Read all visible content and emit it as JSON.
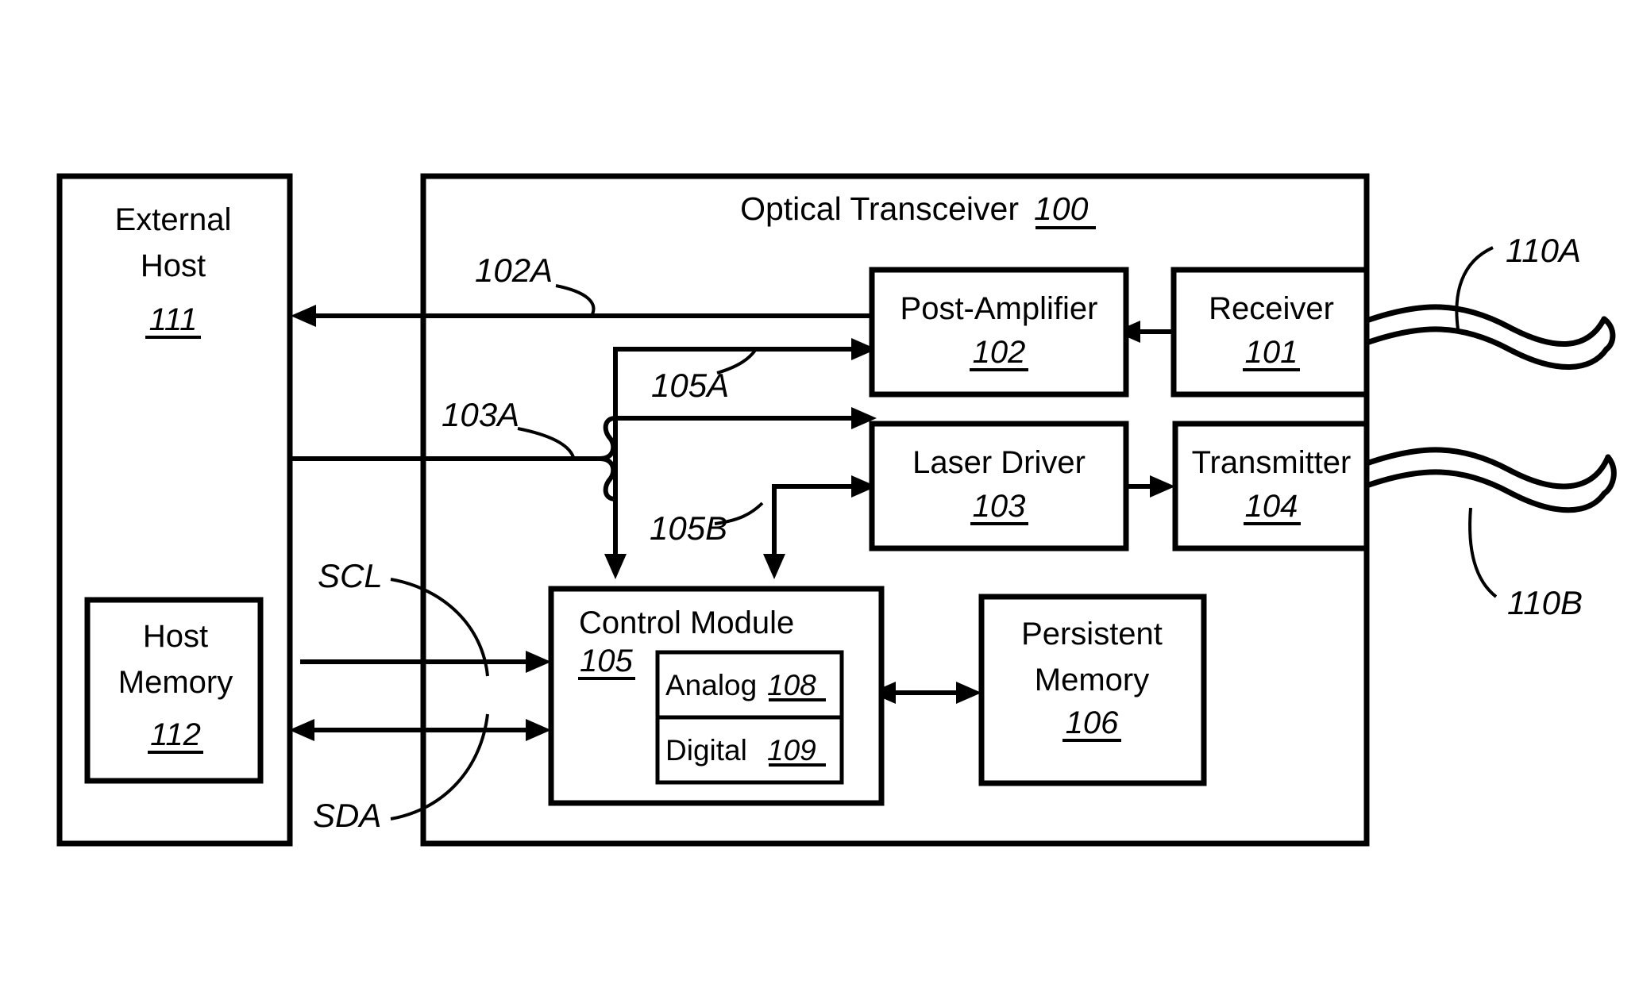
{
  "figure": {
    "type": "patent-block-diagram",
    "background_color": "#ffffff",
    "line_color": "#000000"
  },
  "transceiver": {
    "title": "Optical Transceiver",
    "title_ref": "100"
  },
  "blocks": {
    "external_host": {
      "line1": "External",
      "line2": "Host",
      "ref": "111"
    },
    "host_memory": {
      "line1": "Host",
      "line2": "Memory",
      "ref": "112"
    },
    "post_amplifier": {
      "label": "Post-Amplifier",
      "ref": "102"
    },
    "receiver": {
      "label": "Receiver",
      "ref": "101"
    },
    "laser_driver": {
      "label": "Laser Driver",
      "ref": "103"
    },
    "transmitter": {
      "label": "Transmitter",
      "ref": "104"
    },
    "control_module": {
      "label": "Control Module",
      "ref": "105"
    },
    "analog": {
      "label": "Analog",
      "ref": "108"
    },
    "digital": {
      "label": "Digital",
      "ref": "109"
    },
    "persistent_memory": {
      "line1": "Persistent",
      "line2": "Memory",
      "ref": "106"
    }
  },
  "callouts": {
    "signal_102a": "102A",
    "signal_105a": "105A",
    "signal_103a": "103A",
    "signal_105b": "105B",
    "fiber_110a": "110A",
    "fiber_110b": "110B"
  },
  "bus_labels": {
    "scl": "SCL",
    "sda": "SDA"
  }
}
